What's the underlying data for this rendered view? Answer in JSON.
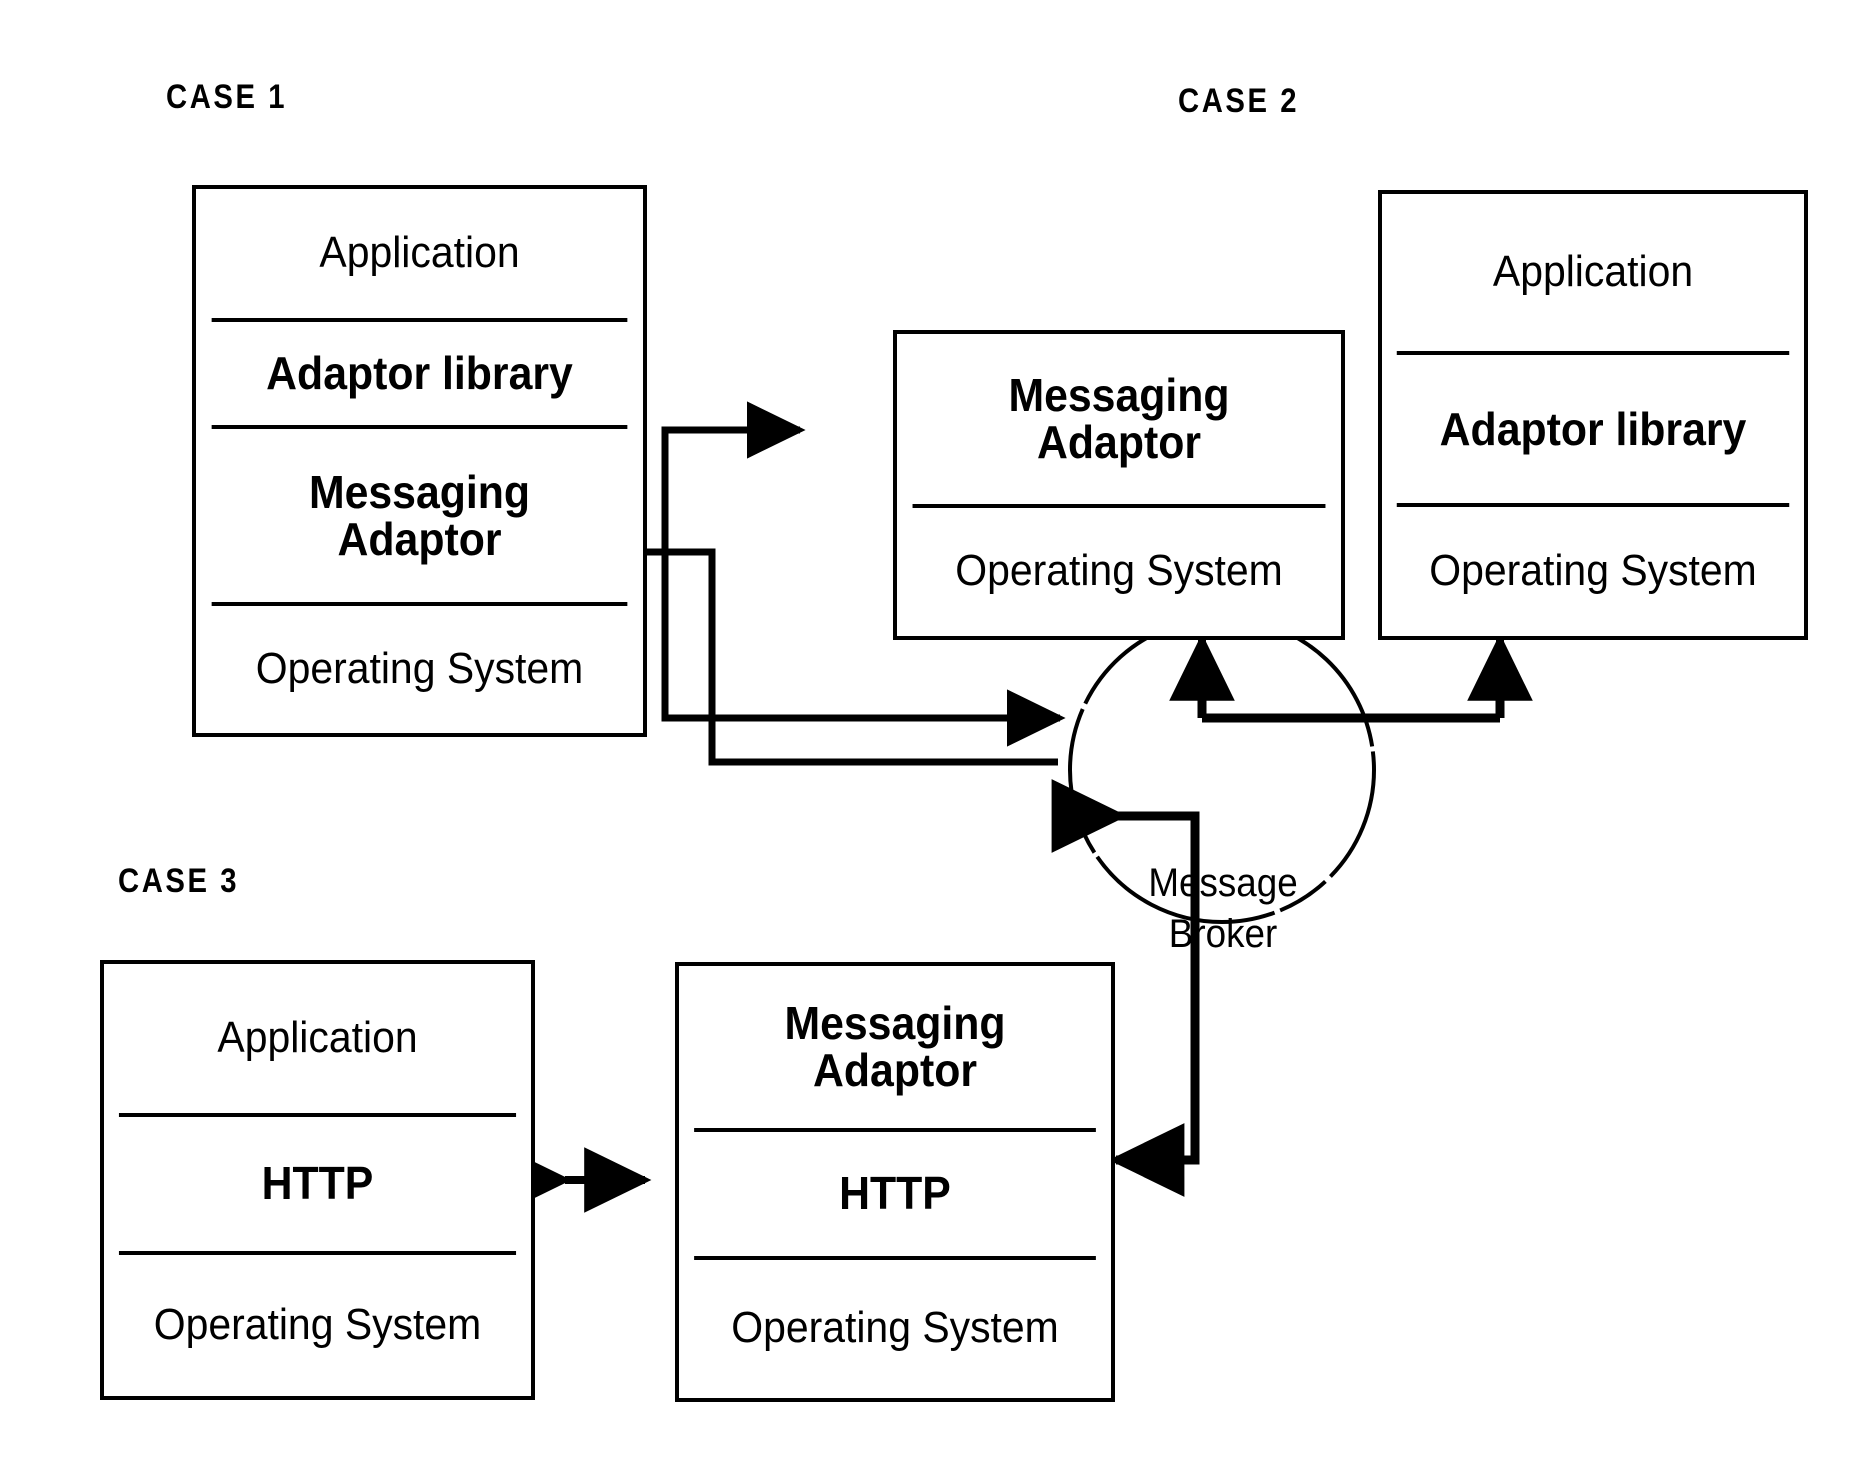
{
  "diagram": {
    "title_case1": "CASE 1",
    "title_case2": "CASE 2",
    "title_case3": "CASE 3",
    "broker": {
      "line1": "Message",
      "line2": "Broker"
    },
    "case1_stack": {
      "rows": [
        {
          "label": "Application",
          "style": "light"
        },
        {
          "label": "Adaptor library",
          "style": "bold"
        },
        {
          "label": "Messaging\nAdaptor",
          "line1": "Messaging",
          "line2": "Adaptor",
          "style": "bold"
        },
        {
          "label": "Operating System",
          "style": "light"
        }
      ]
    },
    "case2_adaptor_stack": {
      "rows": [
        {
          "line1": "Messaging",
          "line2": "Adaptor",
          "style": "bold"
        },
        {
          "label": "Operating System",
          "style": "light"
        }
      ]
    },
    "case2_app_stack": {
      "rows": [
        {
          "label": "Application",
          "style": "light"
        },
        {
          "label": "Adaptor library",
          "style": "bold"
        },
        {
          "label": "Operating System",
          "style": "light"
        }
      ]
    },
    "case3_app_stack": {
      "rows": [
        {
          "label": "Application",
          "style": "light"
        },
        {
          "label": "HTTP",
          "style": "bold"
        },
        {
          "label": "Operating System",
          "style": "light"
        }
      ]
    },
    "case3_adaptor_stack": {
      "rows": [
        {
          "line1": "Messaging",
          "line2": "Adaptor",
          "style": "bold"
        },
        {
          "label": "HTTP",
          "style": "bold"
        },
        {
          "label": "Operating System",
          "style": "light"
        }
      ]
    },
    "colors": {
      "ink": "#000000",
      "paper": "#ffffff"
    }
  }
}
